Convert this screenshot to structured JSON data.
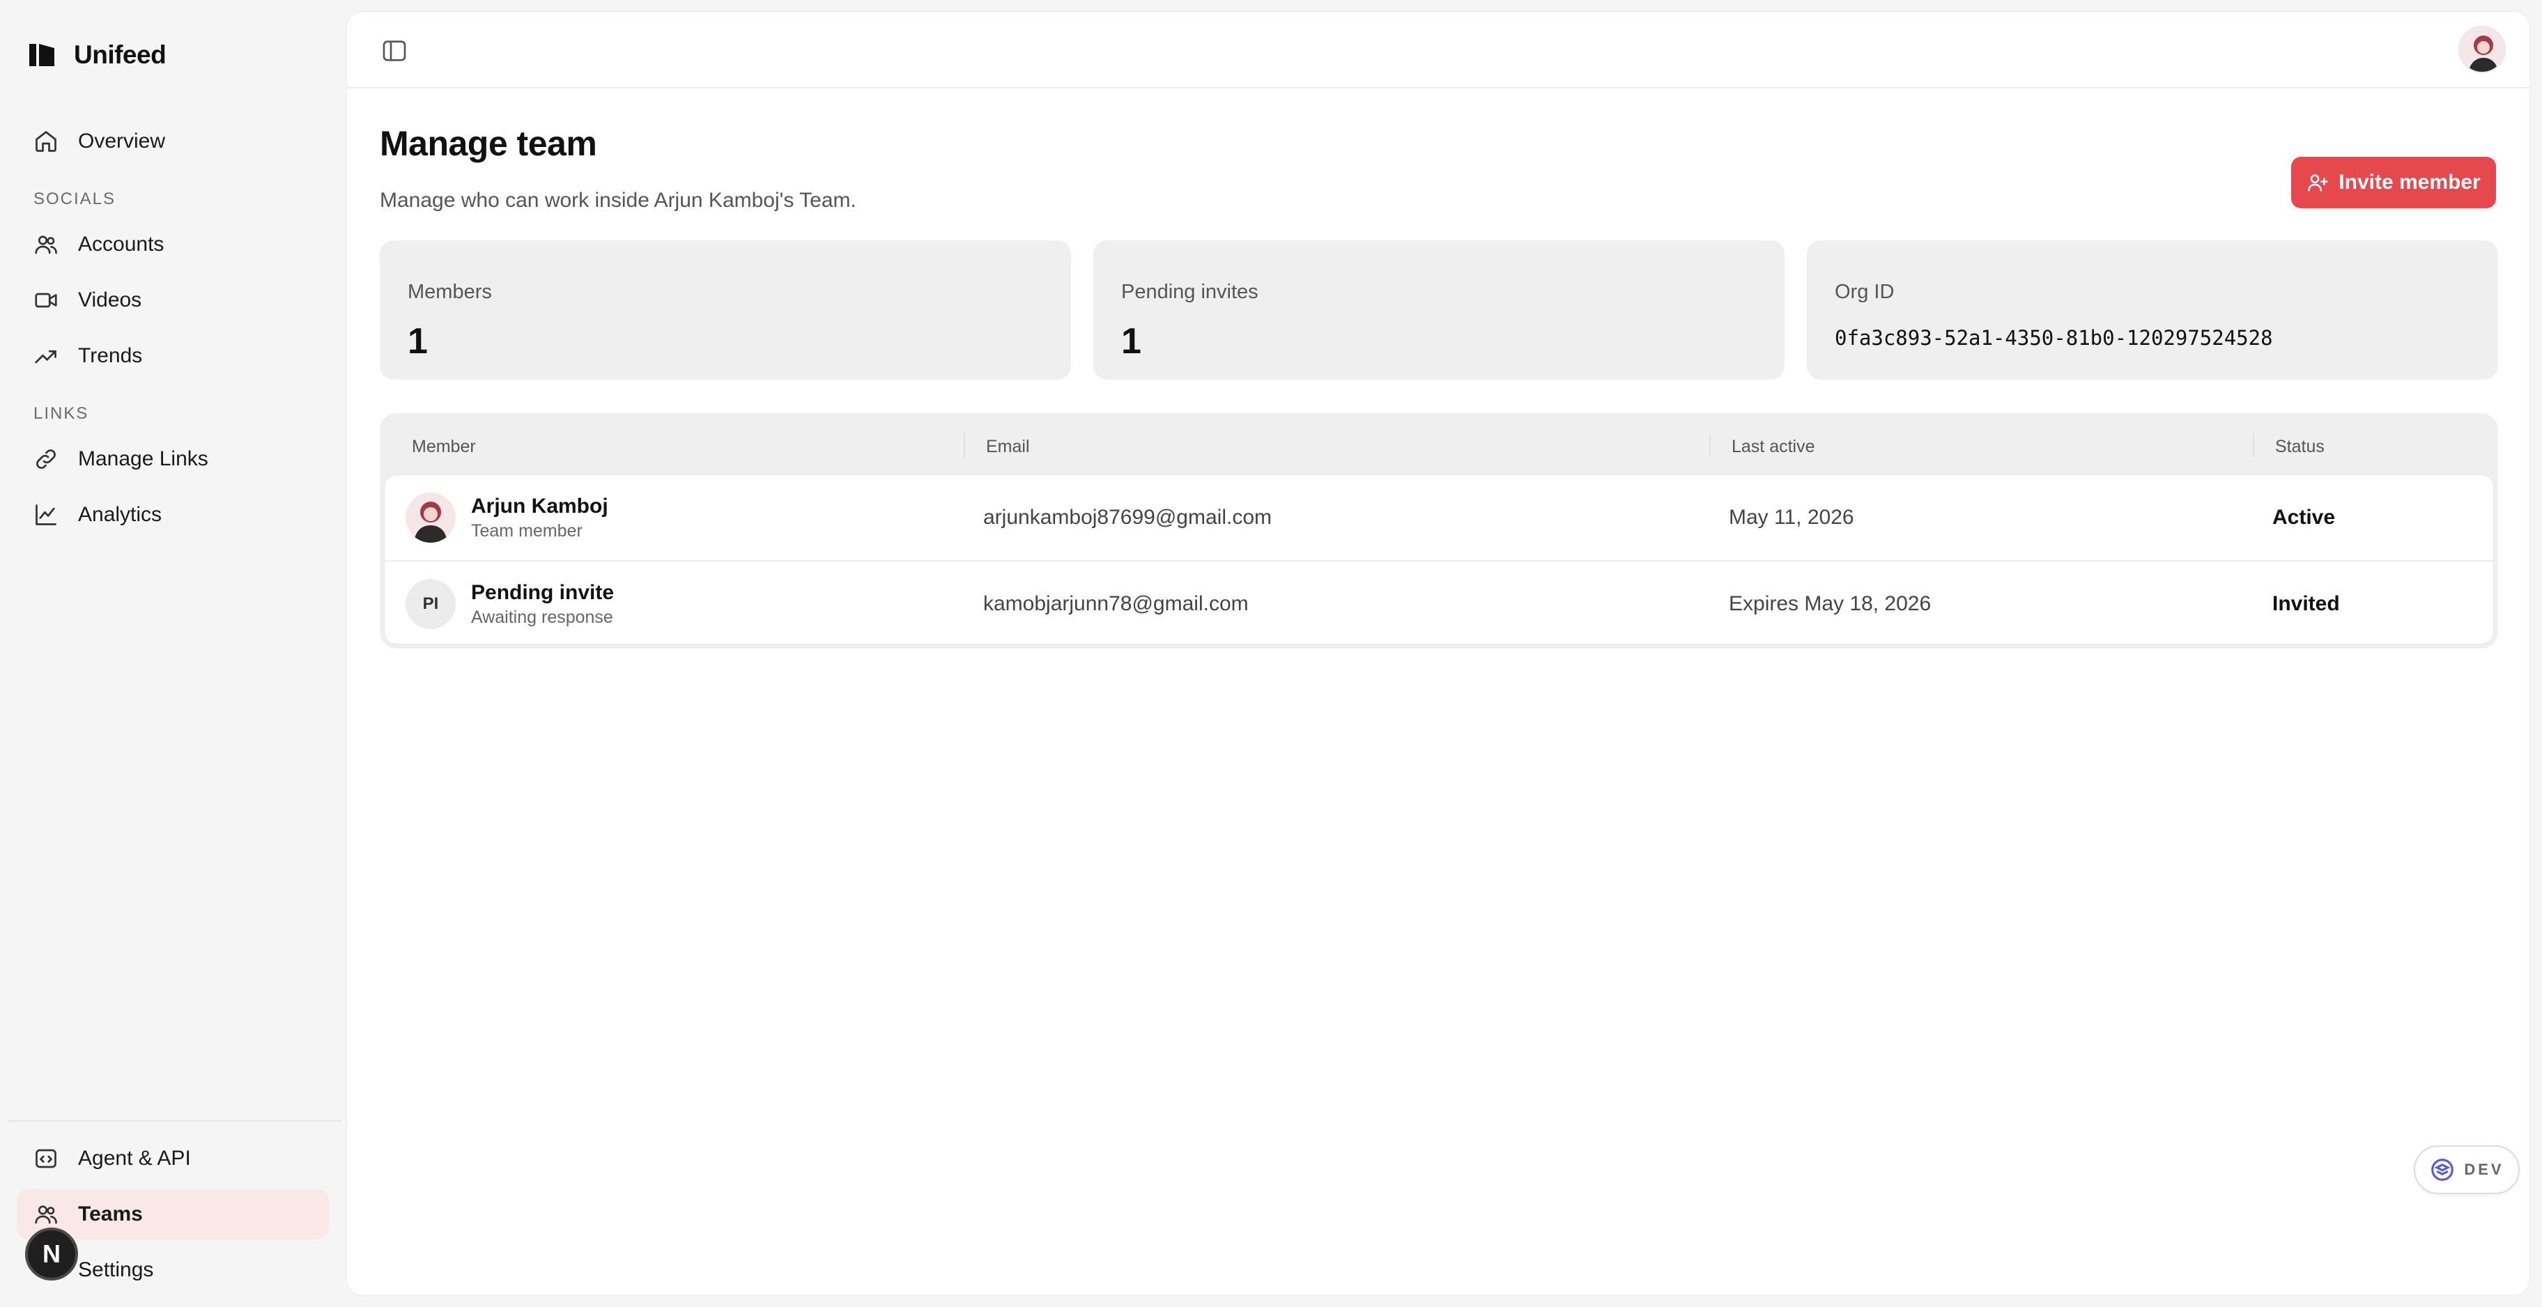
{
  "brand": {
    "name": "Unifeed"
  },
  "sidebar": {
    "overview": "Overview",
    "socials_label": "SOCIALS",
    "accounts": "Accounts",
    "videos": "Videos",
    "trends": "Trends",
    "links_label": "LINKS",
    "manage_links": "Manage Links",
    "analytics": "Analytics",
    "agent_api": "Agent & API",
    "teams": "Teams",
    "settings": "Settings",
    "n_badge": "N"
  },
  "page": {
    "title": "Manage team",
    "subtitle": "Manage who can work inside Arjun Kamboj's Team.",
    "invite_button": "Invite member"
  },
  "stats": {
    "members_label": "Members",
    "members_value": "1",
    "pending_label": "Pending invites",
    "pending_value": "1",
    "org_label": "Org ID",
    "org_value": "0fa3c893-52a1-4350-81b0-120297524528"
  },
  "table": {
    "headers": {
      "member": "Member",
      "email": "Email",
      "last_active": "Last active",
      "status": "Status"
    },
    "rows": [
      {
        "name": "Arjun Kamboj",
        "role": "Team member",
        "email": "arjunkamboj87699@gmail.com",
        "last_active": "May 11, 2026",
        "status": "Active"
      },
      {
        "initials": "PI",
        "name": "Pending invite",
        "role": "Awaiting response",
        "email": "kamobjarjunn78@gmail.com",
        "last_active": "Expires May 18, 2026",
        "status": "Invited"
      }
    ]
  },
  "dev_badge": "DEV",
  "colors": {
    "accent": "#e5484d",
    "active_nav_bg": "#fae8e8",
    "panel_bg": "#ffffff",
    "app_bg": "#f5f5f5"
  }
}
